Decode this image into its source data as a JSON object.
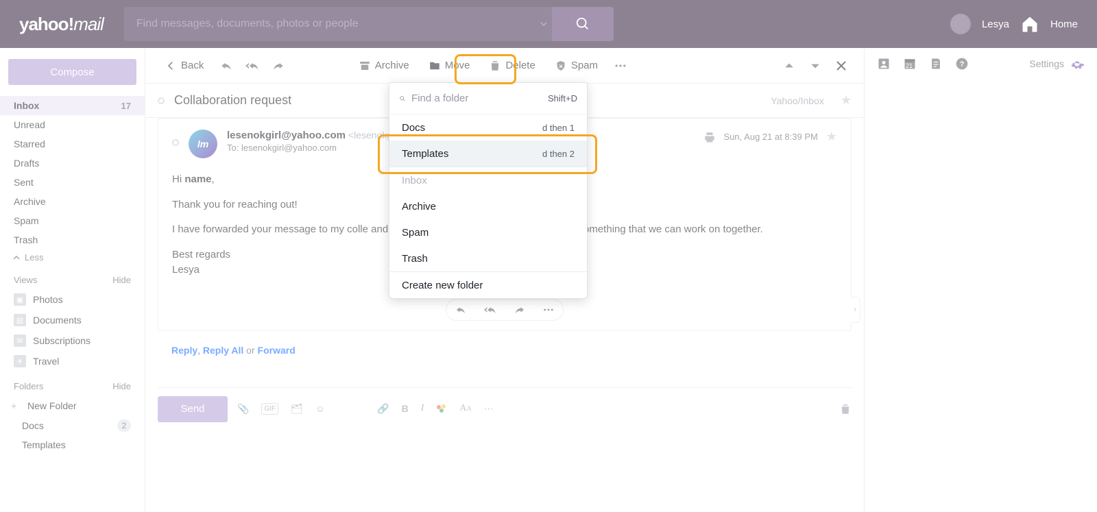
{
  "header": {
    "logo_brand": "yahoo!",
    "logo_prod": "mail",
    "search_placeholder": "Find messages, documents, photos or people",
    "username": "Lesya",
    "home_label": "Home"
  },
  "sidebar": {
    "compose": "Compose",
    "folders": [
      {
        "label": "Inbox",
        "count": "17",
        "active": true
      },
      {
        "label": "Unread"
      },
      {
        "label": "Starred"
      },
      {
        "label": "Drafts"
      },
      {
        "label": "Sent"
      },
      {
        "label": "Archive"
      },
      {
        "label": "Spam"
      },
      {
        "label": "Trash"
      }
    ],
    "less": "Less",
    "views_hdr": "Views",
    "views_hide": "Hide",
    "views": [
      {
        "label": "Photos"
      },
      {
        "label": "Documents"
      },
      {
        "label": "Subscriptions"
      },
      {
        "label": "Travel"
      }
    ],
    "folders_hdr": "Folders",
    "folders_hide": "Hide",
    "new_folder": "New Folder",
    "user_folders": [
      {
        "label": "Docs",
        "count": "2"
      },
      {
        "label": "Templates"
      }
    ]
  },
  "toolbar": {
    "back": "Back",
    "archive": "Archive",
    "move": "Move",
    "delete": "Delete",
    "spam": "Spam"
  },
  "message": {
    "subject": "Collaboration request",
    "location": "Yahoo/Inbox",
    "from_name": "lesenokgirl@yahoo.com",
    "from_addr": "<lesenokgirl@yahoo",
    "to_prefix": "To: ",
    "to_addr": "lesenokgirl@yahoo.com",
    "date": "Sun, Aug 21 at 8:39 PM",
    "body_greet_pre": "Hi ",
    "body_greet_name": "name",
    "body_greet_post": ",",
    "body_p1": "Thank you for reaching out!",
    "body_p2": "I have forwarded your message to my colle                                                   and SEO. They will get back to you if there is something that we can work on together.",
    "body_p3": "Best regards",
    "body_p4": "Lesya"
  },
  "replylinks": {
    "reply": "Reply",
    "comma": ", ",
    "replyall": "Reply All",
    "or": " or ",
    "forward": "Forward"
  },
  "composer": {
    "send": "Send"
  },
  "rail": {
    "cal_badge": "21",
    "settings": "Settings"
  },
  "dropdown": {
    "find_placeholder": "Find a folder",
    "find_hint": "Shift+D",
    "items_user": [
      {
        "label": "Docs",
        "sc": "d then 1"
      },
      {
        "label": "Templates",
        "sc": "d then 2",
        "hover": true
      }
    ],
    "items_sys": [
      {
        "label": "Inbox",
        "disabled": true
      },
      {
        "label": "Archive"
      },
      {
        "label": "Spam"
      },
      {
        "label": "Trash"
      }
    ],
    "create": "Create new folder"
  }
}
